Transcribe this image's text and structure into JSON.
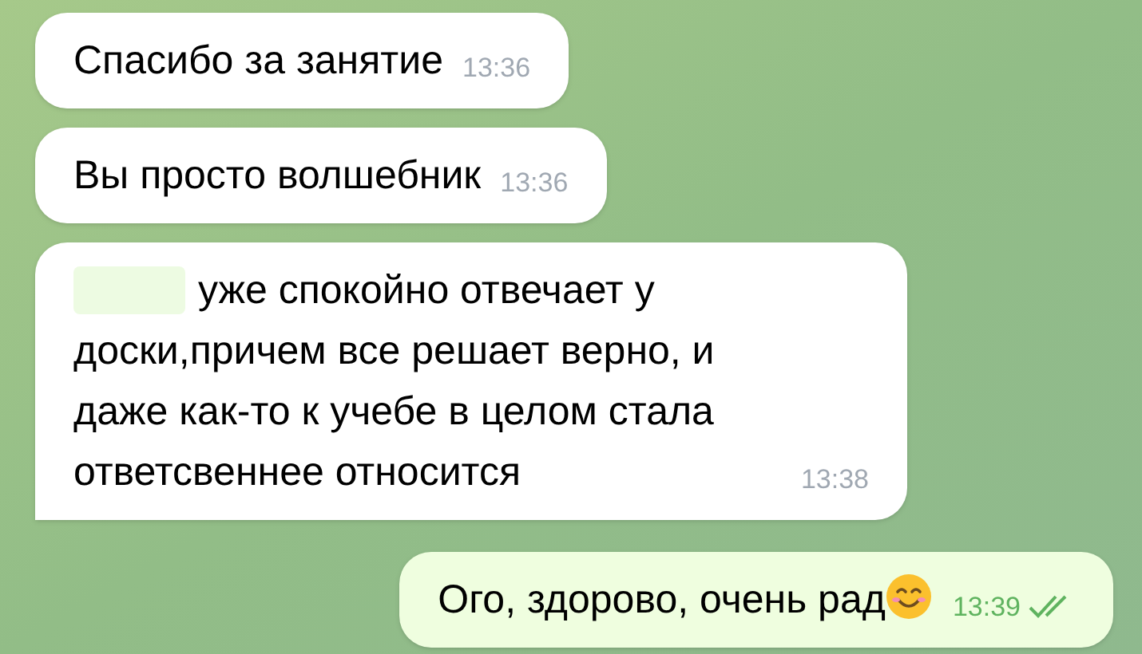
{
  "messages": [
    {
      "kind": "incoming",
      "text": "Спасибо за занятие",
      "time": "13:36",
      "redacted_prefix": false
    },
    {
      "kind": "incoming",
      "text": "Вы просто волшебник",
      "time": "13:36",
      "redacted_prefix": false
    },
    {
      "kind": "incoming",
      "text": "уже спокойно отвечает у доски,причем все решает верно, и даже как-то к учебе в целом стала ответсвеннее относится",
      "time": "13:38",
      "redacted_prefix": true,
      "tail": true
    },
    {
      "kind": "outgoing",
      "text": "Ого, здорово, очень рад",
      "time": "13:39",
      "emoji": true,
      "read": true
    }
  ]
}
